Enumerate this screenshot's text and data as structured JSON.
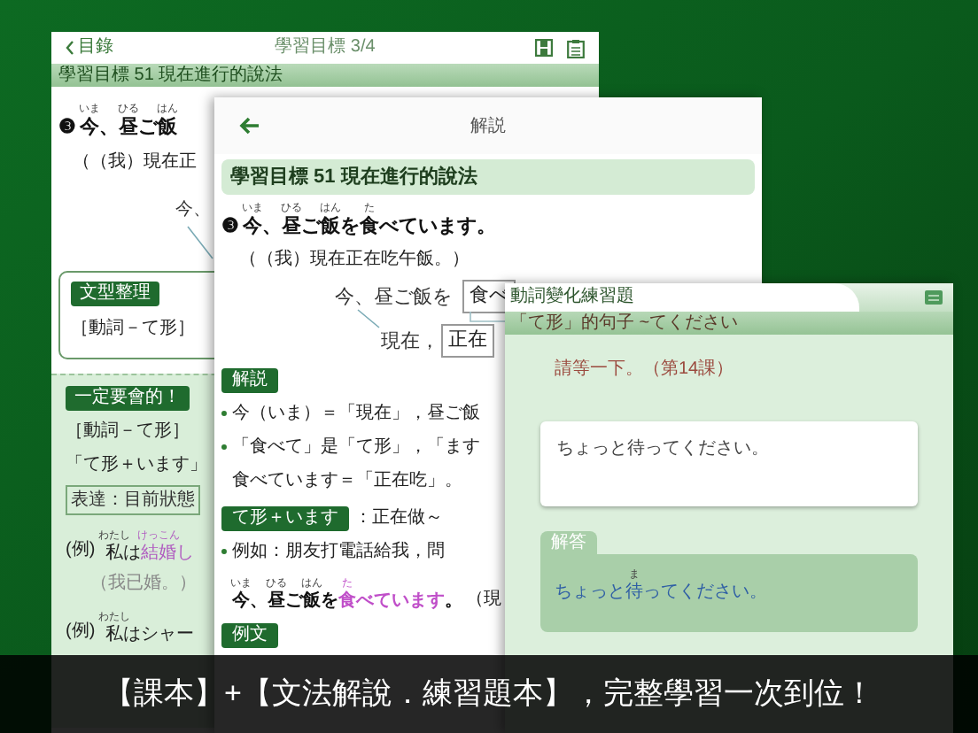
{
  "lesson_window": {
    "back_label": "目錄",
    "title": "學習目標 3/4",
    "section_bar": "學習目標 51 現在進行的說法",
    "sentence": {
      "number": "❸",
      "segments": [
        {
          "t": "今",
          "r": "いま"
        },
        {
          "t": "、"
        },
        {
          "t": "昼",
          "r": "ひる"
        },
        {
          "t": "ご"
        },
        {
          "t": "飯",
          "r": "はん"
        }
      ]
    },
    "translation": "（（我）現在正",
    "diagram_text": "今、",
    "pattern_card": {
      "tag": "文型整理",
      "text": "［動詞－て形］"
    },
    "must_know": {
      "tag": "一定要會的！",
      "items": [
        {
          "kind": "line",
          "segments": [
            {
              "t": "［動詞－て形］"
            }
          ]
        },
        {
          "kind": "line",
          "segments": [
            {
              "t": "「て形＋います」"
            }
          ]
        },
        {
          "kind": "boxed",
          "segments": [
            {
              "t": "表達：目前狀態"
            }
          ]
        },
        {
          "kind": "example",
          "label": "(例)",
          "segments": [
            {
              "t": "私",
              "r": "わたし"
            },
            {
              "t": "は"
            },
            {
              "t": "結婚",
              "r": "けっこん",
              "em": true
            },
            {
              "t": "し",
              "em": true
            }
          ]
        },
        {
          "kind": "translation",
          "segments": [
            {
              "t": "（我已婚。）"
            }
          ]
        },
        {
          "kind": "example",
          "label": "(例)",
          "segments": [
            {
              "t": "私",
              "r": "わたし"
            },
            {
              "t": "はシャー"
            }
          ]
        }
      ]
    }
  },
  "explanation_window": {
    "title": "解説",
    "section_bar": "學習目標 51 現在進行的說法",
    "sentence": {
      "number": "❸",
      "segments": [
        {
          "t": "今",
          "r": "いま"
        },
        {
          "t": "、"
        },
        {
          "t": "昼",
          "r": "ひる"
        },
        {
          "t": "ご"
        },
        {
          "t": "飯",
          "r": "はん"
        },
        {
          "t": "を"
        },
        {
          "t": "食",
          "r": "た"
        },
        {
          "t": "べています。"
        }
      ]
    },
    "translation": "（（我）現在正在吃午飯。）",
    "diagram": {
      "lead": "今、昼ご飯を",
      "box": "食べ",
      "second_lead": "現在，",
      "second_box": "正在"
    },
    "blocks": [
      {
        "kind": "tag",
        "text": "解説"
      },
      {
        "kind": "bullet",
        "segments": [
          {
            "t": "今（いま）＝「現在」，昼ご飯"
          }
        ]
      },
      {
        "kind": "bullet",
        "segments": [
          {
            "t": "「食べて」是「て形」，「ます"
          }
        ]
      },
      {
        "kind": "line",
        "segments": [
          {
            "t": "食べています＝「正在吃」。"
          }
        ]
      },
      {
        "kind": "tag",
        "text": "て形＋います",
        "note": "：正在做～"
      },
      {
        "kind": "bullet",
        "segments": [
          {
            "t": "例如：朋友打電話給我，問"
          }
        ]
      },
      {
        "kind": "example",
        "segments": [
          {
            "t": "今",
            "r": "いま"
          },
          {
            "t": "、"
          },
          {
            "t": "昼",
            "r": "ひる"
          },
          {
            "t": "ご"
          },
          {
            "t": "飯",
            "r": "はん"
          },
          {
            "t": "を"
          },
          {
            "t": "食",
            "r": "た",
            "em": true
          },
          {
            "t": "べています",
            "em": true
          },
          {
            "t": "。"
          }
        ],
        "note": "（現"
      },
      {
        "kind": "tag",
        "text": "例文"
      }
    ]
  },
  "exercise_window": {
    "title": "動詞變化練習題",
    "subtitle": "「て形」的句子 ~てください",
    "prompt": "請等一下。（第14課）",
    "answer_input": {
      "value": "ちょっと待ってください。"
    },
    "answer_panel": {
      "label": "解答",
      "segments": [
        {
          "t": "ちょっと"
        },
        {
          "t": "待",
          "r": "ま"
        },
        {
          "t": "ってください。"
        }
      ]
    }
  },
  "caption": "【課本】+【文法解說．練習題本】，完整學習一次到位！"
}
